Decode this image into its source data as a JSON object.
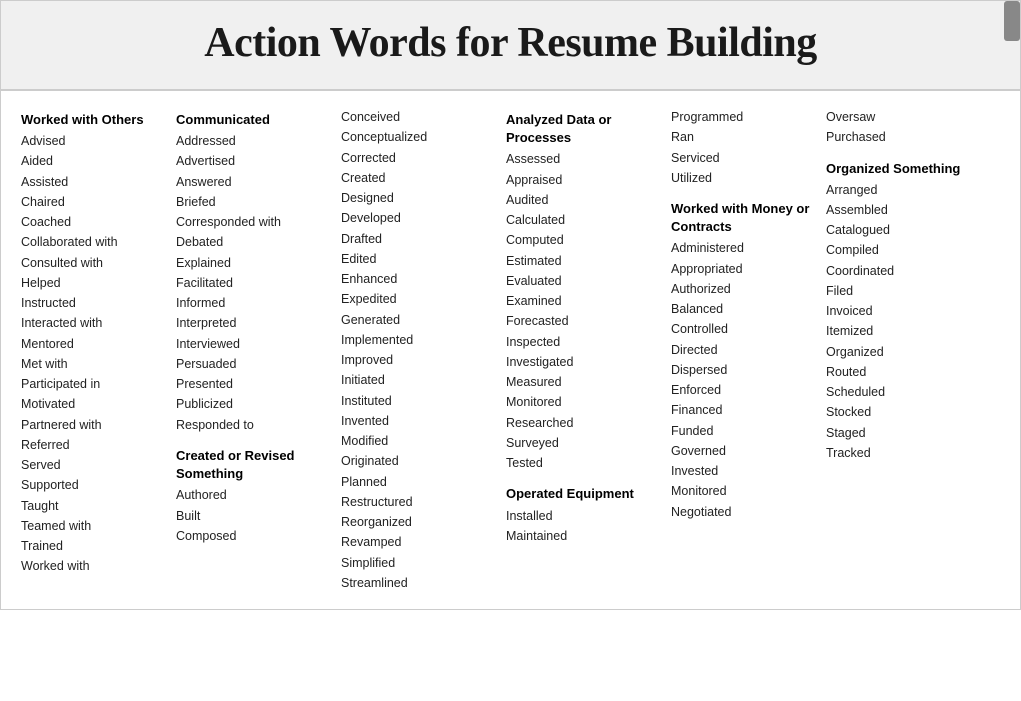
{
  "title": "Action Words for Resume Building",
  "columns": [
    {
      "id": "col1",
      "sections": [
        {
          "header": "Worked with Others",
          "words": [
            "Advised",
            "Aided",
            "Assisted",
            "Chaired",
            "Coached",
            "Collaborated with",
            "Consulted with",
            "Helped",
            "Instructed",
            "Interacted with",
            "Mentored",
            "Met with",
            "Participated in",
            "Motivated",
            "Partnered with",
            "Referred",
            "Served",
            "Supported",
            "Taught",
            "Teamed with",
            "Trained",
            "Worked with"
          ]
        }
      ]
    },
    {
      "id": "col2",
      "sections": [
        {
          "header": "Communicated",
          "words": [
            "Addressed",
            "Advertised",
            "Answered",
            "Briefed",
            "Corresponded with",
            "Debated",
            "Explained",
            "Facilitated",
            "Informed",
            "Interpreted",
            "Interviewed",
            "Persuaded",
            "Presented",
            "Publicized",
            "Responded to"
          ]
        },
        {
          "header": "Created or Revised Something",
          "words": [
            "Authored",
            "Built",
            "Composed"
          ]
        }
      ]
    },
    {
      "id": "col3",
      "sections": [
        {
          "header": null,
          "words": [
            "Conceived",
            "Conceptualized",
            "Corrected",
            "Created",
            "Designed",
            "Developed",
            "Drafted",
            "Edited",
            "Enhanced",
            "Expedited",
            "Generated",
            "Implemented",
            "Improved",
            "Initiated",
            "Instituted",
            "Invented",
            "Modified",
            "Originated",
            "Planned",
            "Restructured",
            "Reorganized",
            "Revamped",
            "Simplified",
            "Streamlined"
          ]
        }
      ]
    },
    {
      "id": "col4",
      "sections": [
        {
          "header": "Analyzed Data or Processes",
          "words": [
            "Assessed",
            "Appraised",
            "Audited",
            "Calculated",
            "Computed",
            "Estimated",
            "Evaluated",
            "Examined",
            "Forecasted",
            "Inspected",
            "Investigated",
            "Measured",
            "Monitored",
            "Researched",
            "Surveyed",
            "Tested"
          ]
        },
        {
          "header": "Operated Equipment",
          "words": [
            "Installed",
            "Maintained"
          ]
        }
      ]
    },
    {
      "id": "col5",
      "sections": [
        {
          "header": null,
          "words": [
            "Programmed",
            "Ran",
            "Serviced",
            "Utilized"
          ]
        },
        {
          "header": "Worked with Money or Contracts",
          "words": [
            "Administered",
            "Appropriated",
            "Authorized",
            "Balanced",
            "Controlled",
            "Directed",
            "Dispersed",
            "Enforced",
            "Financed",
            "Funded",
            "Governed",
            "Invested",
            "Monitored",
            "Negotiated"
          ]
        }
      ]
    },
    {
      "id": "col6",
      "sections": [
        {
          "header": null,
          "words": [
            "Oversaw",
            "Purchased"
          ]
        },
        {
          "header": "Organized Something",
          "words": [
            "Arranged",
            "Assembled",
            "Catalogued",
            "Compiled",
            "Coordinated",
            "Filed",
            "Invoiced",
            "Itemized",
            "Organized",
            "Routed",
            "Scheduled",
            "Stocked",
            "Staged",
            "Tracked"
          ]
        }
      ]
    }
  ]
}
